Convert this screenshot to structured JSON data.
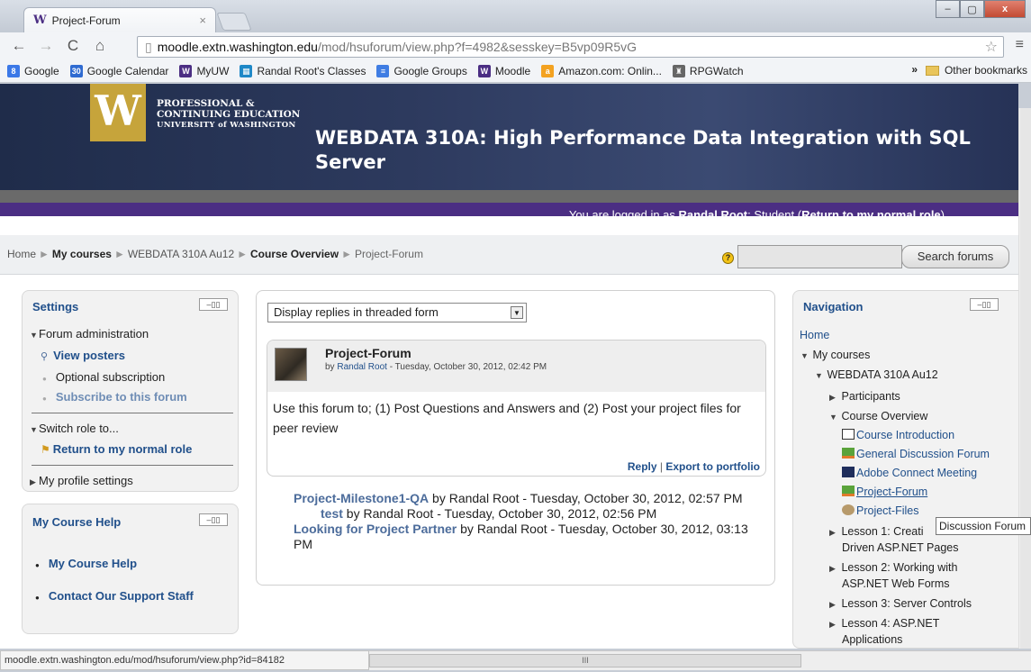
{
  "browser": {
    "tab_title": "Project-Forum",
    "tab_close": "×",
    "url_host": "moodle.extn.washington.edu",
    "url_path": "/mod/hsuforum/view.php?f=4982&sesskey=B5vp09R5vG",
    "bookmarks": [
      {
        "label": "Google",
        "color": "#3b78e7",
        "glyph": "8"
      },
      {
        "label": "Google Calendar",
        "color": "#2f6bd1",
        "glyph": "30"
      },
      {
        "label": "MyUW",
        "color": "#4b2e83",
        "glyph": "W"
      },
      {
        "label": "Randal Root's Classes",
        "color": "#1e88c7",
        "glyph": "▦"
      },
      {
        "label": "Google Groups",
        "color": "#3f7de3",
        "glyph": "≡"
      },
      {
        "label": "Moodle",
        "color": "#4b2e83",
        "glyph": "W"
      },
      {
        "label": "Amazon.com: Onlin...",
        "color": "#f3a221",
        "glyph": "a"
      },
      {
        "label": "RPGWatch",
        "color": "#666666",
        "glyph": "♜"
      }
    ],
    "bookmarks_more": "»",
    "other_bookmarks": "Other bookmarks",
    "status_url": "moodle.extn.washington.edu/mod/hsuforum/view.php?id=84182",
    "hscroll_grip": "III"
  },
  "banner": {
    "w_logo": "W",
    "pce_line1": "PROFESSIONAL &",
    "pce_line2": "CONTINUING EDUCATION",
    "pce_line3": "UNIVERSITY of WASHINGTON",
    "course_title": "WEBDATA 310A: High Performance Data Integration with SQL Server",
    "logged_prefix": "You are logged in as",
    "logged_user": "Randal Root",
    "logged_role": ": Student (",
    "return_role": "Return to my normal role",
    "logged_suffix": ")"
  },
  "breadcrumb": {
    "items": [
      "Home",
      "My courses",
      "WEBDATA 310A Au12",
      "Course Overview",
      "Project-Forum"
    ],
    "sep": "►"
  },
  "search": {
    "button": "Search forums",
    "help": "?"
  },
  "settings": {
    "title": "Settings",
    "dock": "–▯▯",
    "forum_admin": "Forum administration",
    "view_posters": "View posters",
    "optional_sub": "Optional subscription",
    "subscribe": "Subscribe to this forum",
    "switch_role": "Switch role to...",
    "return_role": "Return to my normal role",
    "profile": "My profile settings"
  },
  "course_help": {
    "title": "My Course Help",
    "items": [
      "My Course Help",
      "Contact Our Support Staff"
    ]
  },
  "forum": {
    "display_mode": "Display replies in threaded form",
    "post_title": "Project-Forum",
    "post_by": "by",
    "post_author": "Randal Root",
    "post_date": " - Tuesday, October 30, 2012, 02:42 PM",
    "post_body": "Use this forum to; (1) Post Questions and Answers and (2) Post your project files for peer review",
    "reply": "Reply",
    "export": "Export to portfolio",
    "link_sep": " | ",
    "replies": [
      {
        "title": "Project-Milestone1-QA",
        "meta": " by Randal Root - Tuesday, October 30, 2012, 02:57 PM"
      },
      {
        "title": "test",
        "meta": " by Randal Root - Tuesday, October 30, 2012, 02:56 PM"
      },
      {
        "title": "Looking for Project Partner",
        "meta": " by Randal Root - Tuesday, October 30, 2012, 03:13 PM"
      }
    ]
  },
  "navigation": {
    "title": "Navigation",
    "home": "Home",
    "my_courses": "My courses",
    "course": "WEBDATA 310A Au12",
    "participants": "Participants",
    "course_overview": "Course Overview",
    "activities": [
      "Course Introduction",
      "General Discussion Forum",
      "Adobe Connect Meeting",
      "Project-Forum",
      "Project-Files"
    ],
    "lessons": [
      [
        "Lesson 1: Creati",
        "Driven ASP.NET Pages"
      ],
      [
        "Lesson 2: Working with",
        "ASP.NET Web Forms"
      ],
      [
        "Lesson 3: Server Controls"
      ],
      [
        "Lesson 4: ASP.NET",
        "Applications"
      ]
    ],
    "tooltip": "Discussion Forum"
  }
}
